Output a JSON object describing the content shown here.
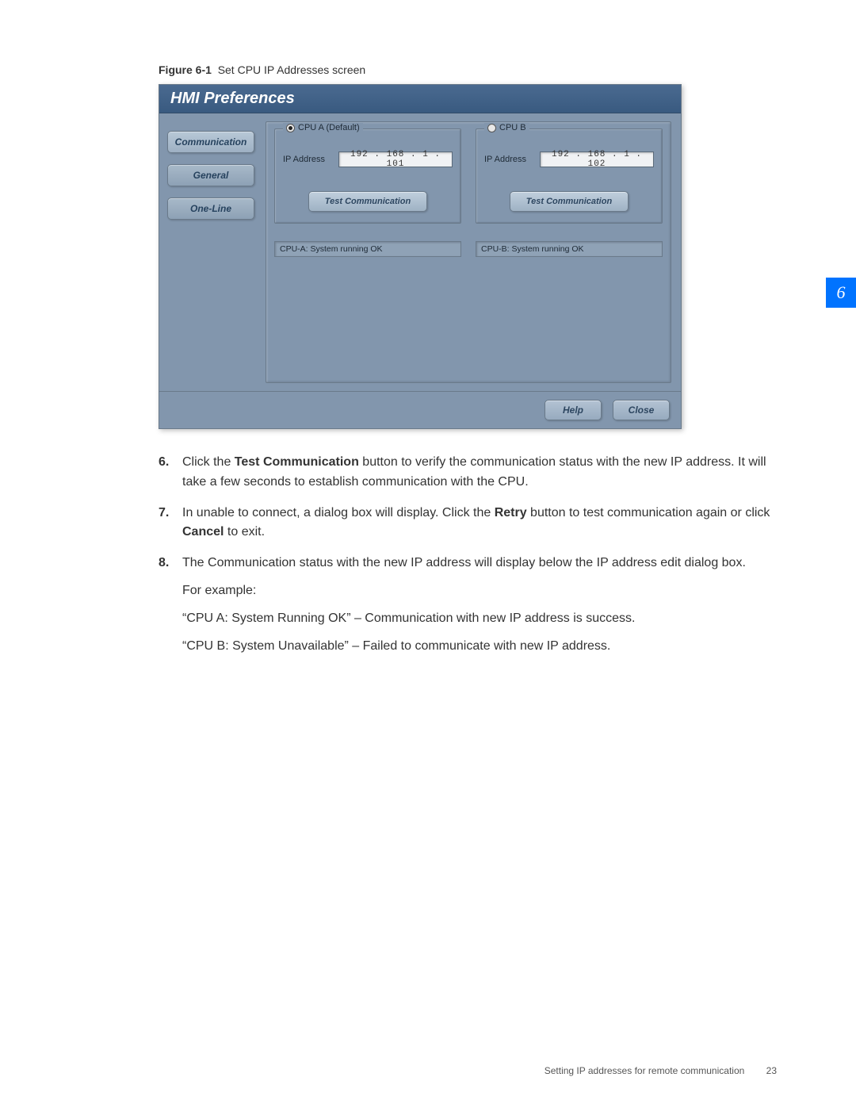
{
  "figure": {
    "label": "Figure 6-1",
    "title": "Set CPU IP Addresses screen"
  },
  "window": {
    "title": "HMI Preferences",
    "tabs": [
      "Communication",
      "General",
      "One-Line"
    ],
    "cpuA": {
      "legend": "CPU A (Default)",
      "ip_label": "IP Address",
      "ip_value": "192 . 168 .  1  . 101",
      "test_btn": "Test Communication",
      "status": "CPU-A: System running OK"
    },
    "cpuB": {
      "legend": "CPU B",
      "ip_label": "IP Address",
      "ip_value": "192 . 168 .  1  . 102",
      "test_btn": "Test Communication",
      "status": "CPU-B: System running OK"
    },
    "footer": {
      "help": "Help",
      "close": "Close"
    }
  },
  "steps": {
    "s6_num": "6.",
    "s6_a": "Click the ",
    "s6_b": "Test Communication",
    "s6_c": " button to verify the communication status with the new IP address. It will take a few seconds to establish communication with the CPU.",
    "s7_num": "7.",
    "s7_a": "In unable to connect, a dialog box will display. Click the ",
    "s7_b": "Retry",
    "s7_c": " button to test communication again or click ",
    "s7_d": "Cancel",
    "s7_e": " to exit.",
    "s8_num": "8.",
    "s8_a": "The Communication status with the new IP address will display below the IP address edit dialog box.",
    "s8_ex": "For example:",
    "s8_ok": "“CPU A: System Running OK” – Communication with new IP address is success.",
    "s8_un": "“CPU B: System Unavailable” – Failed to communicate with new IP address."
  },
  "chapter_tab": "6",
  "footer": {
    "section": "Setting IP addresses for remote communication",
    "page": "23"
  }
}
